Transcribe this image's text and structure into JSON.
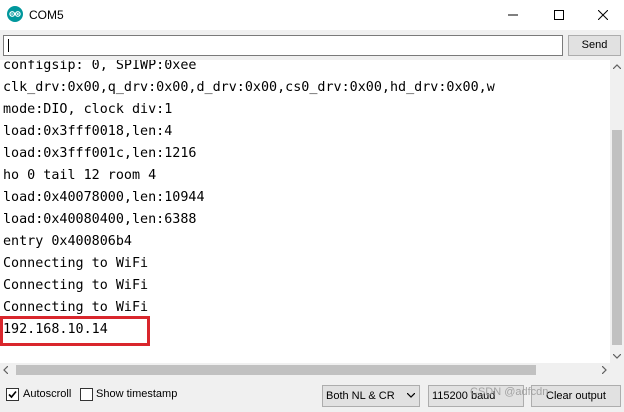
{
  "window": {
    "title": "COM5",
    "controls": {
      "minimize": "minimize-icon",
      "maximize": "maximize-icon",
      "close": "close-icon"
    }
  },
  "input_bar": {
    "value": "",
    "send_label": "Send"
  },
  "monitor": {
    "lines": [
      "configsip: 0, SPIWP:0xee",
      "clk_drv:0x00,q_drv:0x00,d_drv:0x00,cs0_drv:0x00,hd_drv:0x00,w",
      "mode:DIO, clock div:1",
      "load:0x3fff0018,len:4",
      "load:0x3fff001c,len:1216",
      "ho 0 tail 12 room 4",
      "load:0x40078000,len:10944",
      "load:0x40080400,len:6388",
      "entry 0x400806b4",
      "Connecting to WiFi",
      "Connecting to WiFi",
      "Connecting to WiFi",
      "192.168.10.14"
    ],
    "highlight_color": "#d9262c"
  },
  "status_bar": {
    "autoscroll_label": "Autoscroll",
    "autoscroll_checked": true,
    "timestamp_label": "Show timestamp",
    "timestamp_checked": false,
    "line_ending": "Both NL & CR",
    "baud_rate": "115200 baud",
    "clear_label": "Clear output"
  },
  "watermark": "CSDN @adfcdn"
}
